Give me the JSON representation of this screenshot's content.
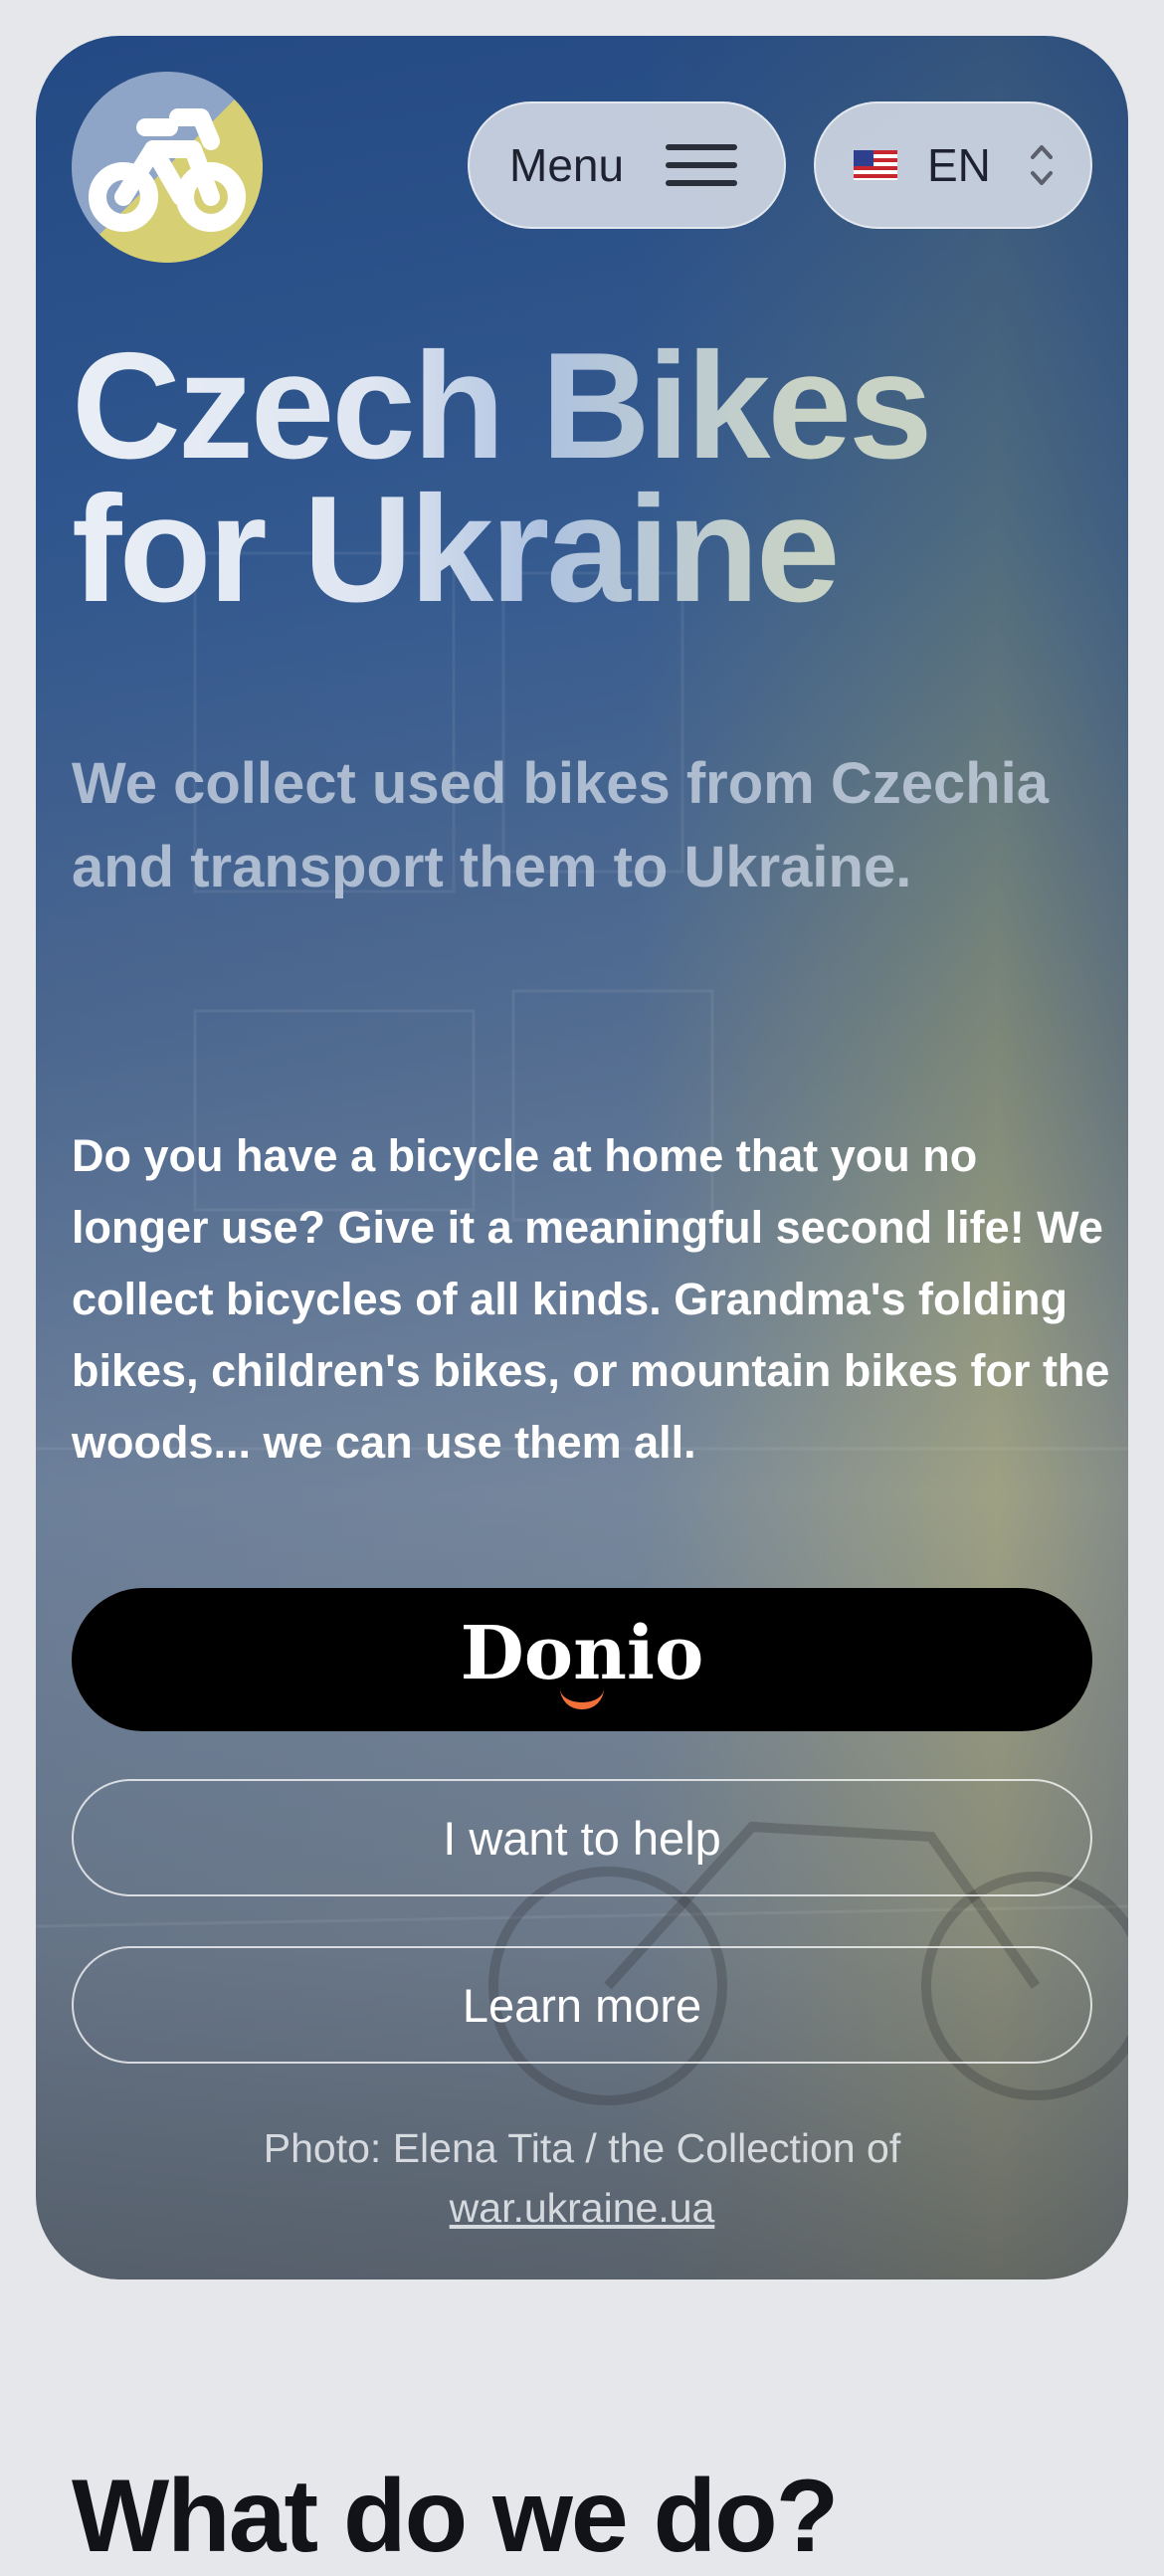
{
  "header": {
    "logo_icon": "bicycle-logo-icon",
    "menu_label": "Menu",
    "menu_icon": "hamburger-icon",
    "language": {
      "flag_icon": "us-flag-icon",
      "selected": "EN",
      "chevron_icon": "up-down-chevron-icon"
    }
  },
  "hero": {
    "title_line1": "Czech Bikes",
    "title_line2": "for Ukraine",
    "subtitle": "We collect used bikes from Czechia and transport them to Ukraine.",
    "body": "Do you have a bicycle at home that you no longer use? Give it a meaningful second life! We collect bicycles of all kinds. Grandma's folding bikes, children's bikes, or mountain bikes for the woods... we can use them all.",
    "donate_button_label": "Donio",
    "help_button_label": "I want to help",
    "learn_more_label": "Learn more",
    "photo_credit_prefix": "Photo: Elena Tita / the Collection of",
    "photo_credit_link": "war.ukraine.ua"
  },
  "next_section": {
    "heading": "What do we do?"
  },
  "colors": {
    "page_background": "#e6e7ea",
    "hero_blue": "#3b5f93",
    "hero_yellow": "#a9a860",
    "logo_blue": "#8fa5c7",
    "logo_yellow": "#d6cf74",
    "donio_accent": "#f1703a"
  }
}
